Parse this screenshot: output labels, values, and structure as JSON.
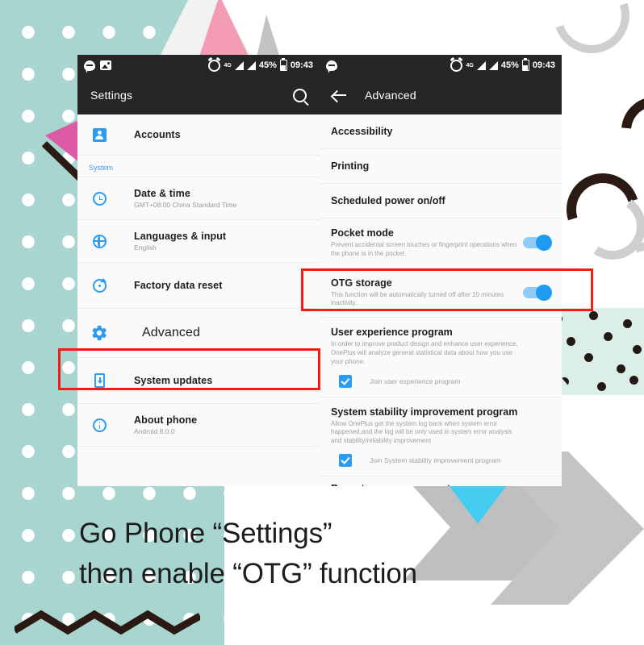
{
  "caption": {
    "line1": "Go Phone “Settings”",
    "line2": "then enable “OTG” function"
  },
  "colors": {
    "accent_blue": "#2b9bf4",
    "highlight_red": "#f51c16",
    "teal_bg": "#a8d5d0",
    "status_bar": "#262626",
    "switch_on": "#1e9bf0"
  },
  "status_bar": {
    "icons_left": [
      "chat-bubble-icon",
      "photo-icon"
    ],
    "alarm_icon": "alarm-icon",
    "network_label": "4G",
    "signal_icons": [
      "signal-bars-icon",
      "signal-bars-icon"
    ],
    "battery_percent": "45%",
    "battery_icon": "battery-icon",
    "time": "09:43"
  },
  "left_phone": {
    "appbar": {
      "title": "Settings",
      "search_icon": "search-icon"
    },
    "items": [
      {
        "label": "Accounts",
        "sub": "",
        "icon": "accounts-icon"
      }
    ],
    "section_header": "System",
    "system_items": [
      {
        "label": "Date & time",
        "sub": "GMT+08:00 China Standard Time",
        "icon": "clock-icon"
      },
      {
        "label": "Languages & input",
        "sub": "English",
        "icon": "globe-icon"
      },
      {
        "label": "Factory data reset",
        "sub": "",
        "icon": "reset-icon"
      },
      {
        "label": "Advanced",
        "sub": "",
        "icon": "gear-icon"
      },
      {
        "label": "System updates",
        "sub": "",
        "icon": "system-update-icon"
      },
      {
        "label": "About phone",
        "sub": "Android 8.0.0",
        "icon": "info-icon"
      }
    ]
  },
  "right_phone": {
    "appbar": {
      "title": "Advanced",
      "back_icon": "back-arrow-icon"
    },
    "items": [
      {
        "label": "Accessibility",
        "sub": "",
        "toggle": null
      },
      {
        "label": "Printing",
        "sub": "",
        "toggle": null
      },
      {
        "label": "Scheduled power on/off",
        "sub": "",
        "toggle": null
      },
      {
        "label": "Pocket mode",
        "sub": "Prevent accidental screen touches or fingerprint operations when the phone is in the pocket",
        "toggle": "on"
      },
      {
        "label": "OTG storage",
        "sub": "This function will be automatically turned off after 10 minutes inactivity.",
        "toggle": "on"
      },
      {
        "label": "User experience program",
        "sub": "In order to improve product design and enhance user experience, OnePlus will analyze general statistical data about how you use your phone.",
        "checkbox_label": "Join user experience program",
        "checkbox_checked": true
      },
      {
        "label": "System stability improvement program",
        "sub": "Allow OnePlus get the system log back when system error happened,and the log will be only used in system error analysis and stability/reliability improvement",
        "checkbox_label": "Join System stability improvement program",
        "checkbox_checked": true
      }
    ],
    "clipped_item": "Recent app management"
  },
  "highlights": [
    {
      "target": "Advanced",
      "color": "#f51c16"
    },
    {
      "target": "OTG storage",
      "color": "#f51c16"
    }
  ]
}
